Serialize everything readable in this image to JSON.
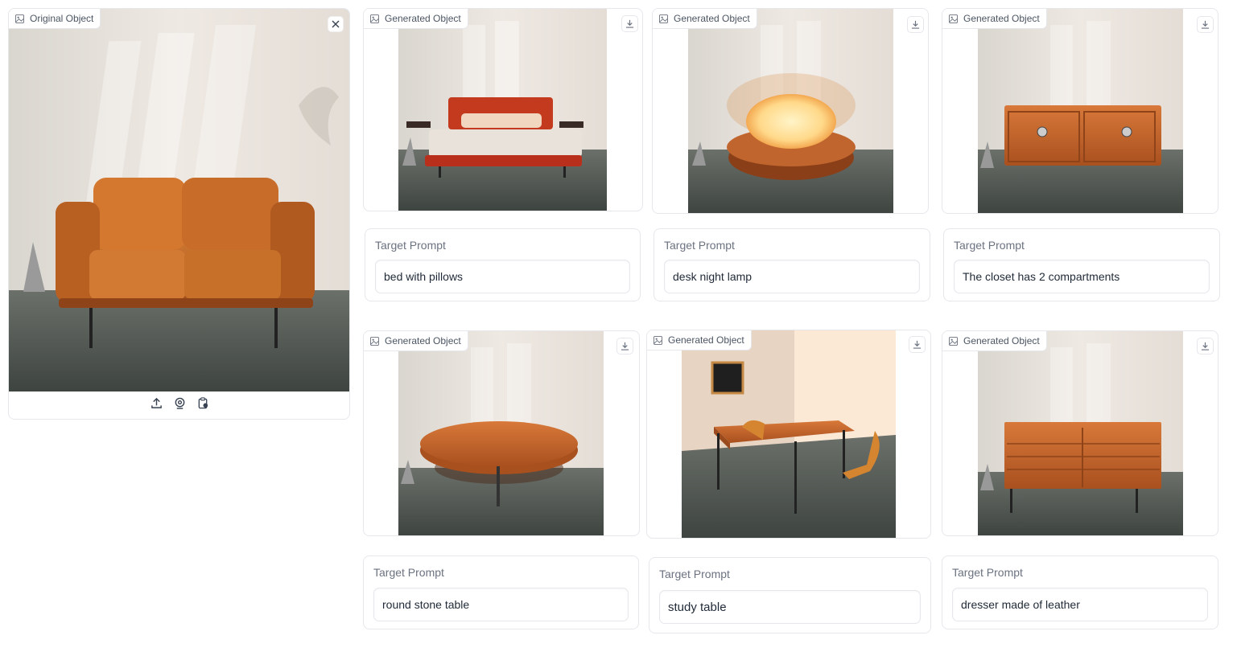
{
  "original": {
    "badge_label": "Original Object",
    "badge_icon": "image-icon",
    "close_icon": "close-icon",
    "tools": [
      "upload-icon",
      "webcam-icon",
      "clipboard-icon"
    ]
  },
  "generated_label": "Generated Object",
  "download_icon": "download-icon",
  "prompt_label": "Target Prompt",
  "results": [
    {
      "object": "bed",
      "prompt": "bed with pillows"
    },
    {
      "object": "lamp",
      "prompt": "desk night lamp"
    },
    {
      "object": "closet",
      "prompt": "The closet has 2 compartments"
    },
    {
      "object": "round-table",
      "prompt": "round stone table"
    },
    {
      "object": "study-table",
      "prompt": "study table"
    },
    {
      "object": "dresser",
      "prompt": "dresser made of leather"
    }
  ],
  "colors": {
    "wall": "#e8e2dc",
    "floor": "#4a5048",
    "leather": "#c96a28",
    "wood": "#c9652a",
    "border": "#e5e7eb"
  }
}
